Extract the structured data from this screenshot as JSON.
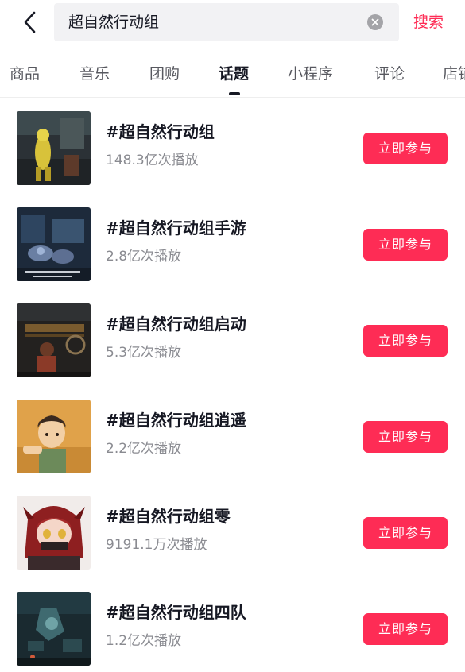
{
  "search": {
    "query": "超自然行动组",
    "submit_label": "搜索"
  },
  "tabs": [
    {
      "label": "商品"
    },
    {
      "label": "音乐"
    },
    {
      "label": "团购"
    },
    {
      "label": "话题",
      "active": true
    },
    {
      "label": "小程序"
    },
    {
      "label": "评论"
    },
    {
      "label": "店铺"
    }
  ],
  "topics": [
    {
      "title": "#超自然行动组",
      "plays": "148.3亿次播放",
      "action": "立即参与",
      "thumb": "game-character-yellow"
    },
    {
      "title": "#超自然行动组手游",
      "plays": "2.8亿次播放",
      "action": "立即参与",
      "thumb": "game-scene-blue"
    },
    {
      "title": "#超自然行动组启动",
      "plays": "5.3亿次播放",
      "action": "立即参与",
      "thumb": "game-scene-dark"
    },
    {
      "title": "#超自然行动组逍遥",
      "plays": "2.2亿次播放",
      "action": "立即参与",
      "thumb": "cartoon-boy-orange"
    },
    {
      "title": "#超自然行动组零",
      "plays": "9191.1万次播放",
      "action": "立即参与",
      "thumb": "anime-girl-red-hood"
    },
    {
      "title": "#超自然行动组四队",
      "plays": "1.2亿次播放",
      "action": "立即参与",
      "thumb": "game-scene-teal"
    }
  ],
  "colors": {
    "accent": "#fe2c55",
    "text_primary": "#161823",
    "text_secondary": "#8a8b91"
  }
}
